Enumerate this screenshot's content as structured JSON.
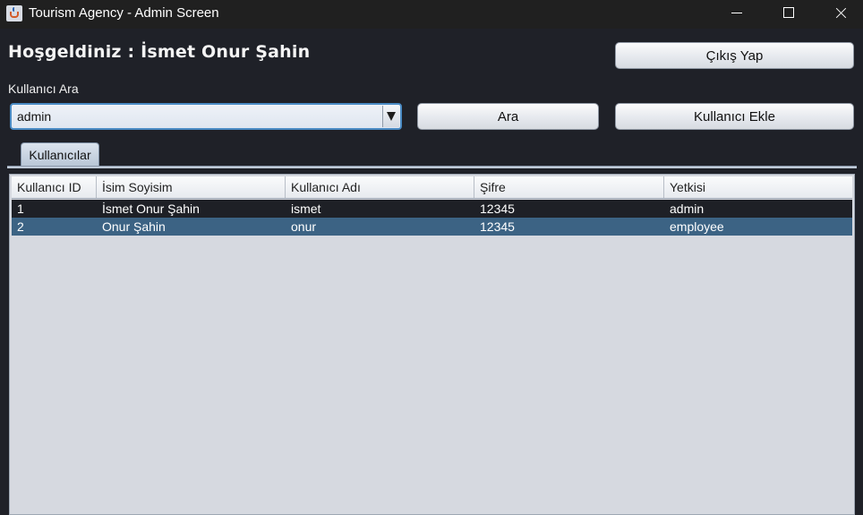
{
  "window": {
    "title": "Tourism Agency - Admin Screen",
    "icon": "java-cup-icon"
  },
  "header": {
    "welcome_text": "Hoşgeldiniz : İsmet Onur Şahin",
    "logout_label": "Çıkış Yap"
  },
  "search": {
    "label": "Kullanıcı Ara",
    "selected_value": "admin",
    "search_button_label": "Ara",
    "add_user_button_label": "Kullanıcı Ekle"
  },
  "tabs": [
    {
      "label": "Kullanıcılar",
      "active": true
    }
  ],
  "table": {
    "columns": [
      "Kullanıcı ID",
      "İsim Soyisim",
      "Kullanıcı Adı",
      "Şifre",
      "Yetkisi"
    ],
    "rows": [
      [
        "1",
        "İsmet Onur Şahin",
        "ismet",
        "12345",
        "admin"
      ],
      [
        "2",
        "Onur Şahin",
        "onur",
        "12345",
        "employee"
      ]
    ],
    "selected_row_index": 1
  },
  "colors": {
    "background": "#1f2128",
    "accent_focus": "#4a8bc4",
    "selected_row": "#3c6384",
    "table_background": "#d6d9e0"
  }
}
